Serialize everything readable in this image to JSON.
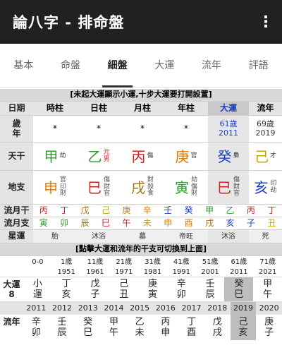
{
  "appbar": {
    "title": "論八字 - 排命盤",
    "more_icon": "more-vert-icon"
  },
  "tabs": [
    "基本",
    "命盤",
    "細盤",
    "大運",
    "流年",
    "評語"
  ],
  "active_tab": "細盤",
  "banner1": "[未起大運顯示小運,十步大運要打開設置]",
  "header": [
    "日期",
    "時柱",
    "日柱",
    "月柱",
    "年柱",
    "大運",
    "流年"
  ],
  "sui": {
    "label": "歲\n年",
    "c5": "61歲\n2011",
    "c6": "69歲\n2019",
    "dots": [
      "*",
      "*",
      "*",
      "*"
    ]
  },
  "tiangan": {
    "label": "天干",
    "cells": [
      {
        "char": "甲",
        "note": "劫"
      },
      {
        "char": "乙",
        "note": "元\n男"
      },
      {
        "char": "丙",
        "note": "傷"
      },
      {
        "char": "庚",
        "note": "官"
      },
      {
        "char": "癸",
        "note": "梟"
      },
      {
        "char": "己",
        "note": "才"
      }
    ]
  },
  "dizhi": {
    "label": "地支",
    "cells": [
      {
        "char": "申",
        "note": "官\n印\n財"
      },
      {
        "char": "巳",
        "note": "傷\n財\n官"
      },
      {
        "char": "戌",
        "note": "財\n殺\n食"
      },
      {
        "char": "寅",
        "note": "劫\n傷\n財"
      },
      {
        "char": "巳",
        "note": "傷\n財\n官"
      },
      {
        "char": "亥",
        "note": "印\n劫"
      }
    ]
  },
  "liuyue_gan": {
    "label": "流月干",
    "chars": [
      "丙",
      "丁",
      "戊",
      "己",
      "庚",
      "辛",
      "壬",
      "癸",
      "甲",
      "乙",
      "丙",
      "丁"
    ]
  },
  "liuyue_zhi": {
    "label": "流月支",
    "chars": [
      "寅",
      "卯",
      "辰",
      "巳",
      "午",
      "未",
      "申",
      "酉",
      "戌",
      "亥",
      "子",
      "丑"
    ]
  },
  "xingyun": {
    "label": "星運",
    "cells": [
      "胎",
      "沐浴",
      "墓",
      "帝旺",
      "沐浴",
      "死"
    ]
  },
  "banner2": "[點擊大運和流年的干支可切換到上面]",
  "dayun_ages": [
    {
      "age": "0-0",
      "year": ""
    },
    {
      "age": "1歲",
      "year": "1951"
    },
    {
      "age": "11歲",
      "year": "1961"
    },
    {
      "age": "21歲",
      "year": "1971"
    },
    {
      "age": "31歲",
      "year": "1981"
    },
    {
      "age": "41歲",
      "year": "1991"
    },
    {
      "age": "51歲",
      "year": "2001"
    },
    {
      "age": "61歲",
      "year": "2011"
    },
    {
      "age": "71歲",
      "year": "2021"
    }
  ],
  "dayun_label": "大運\n8",
  "dayun_pillars": [
    "小\n運",
    "丁\n亥",
    "戊\n子",
    "己\n丑",
    "庚\n寅",
    "辛\n卯",
    "壬\n辰",
    "癸\n巳",
    "甲\n午"
  ],
  "years": [
    "2011",
    "2012",
    "2013",
    "2014",
    "2015",
    "2016",
    "2017",
    "2018",
    "2019",
    "2020"
  ],
  "liunian_label": "流年",
  "liunian_pillars": [
    "辛\n卯",
    "壬\n辰",
    "癸\n巳",
    "甲\n午",
    "乙\n未",
    "丙\n申",
    "丁\n酉",
    "戊\n戌",
    "己\n亥",
    "庚\n子"
  ],
  "colors": {
    "appbar": "#212121",
    "wood": "#2e9d2e",
    "fire": "#d02020",
    "earth": "#a8761e",
    "metal": "#e07a00",
    "water": "#1c3fc4",
    "earth2": "#c9a400",
    "dayun_header": "#1a3cc7"
  }
}
